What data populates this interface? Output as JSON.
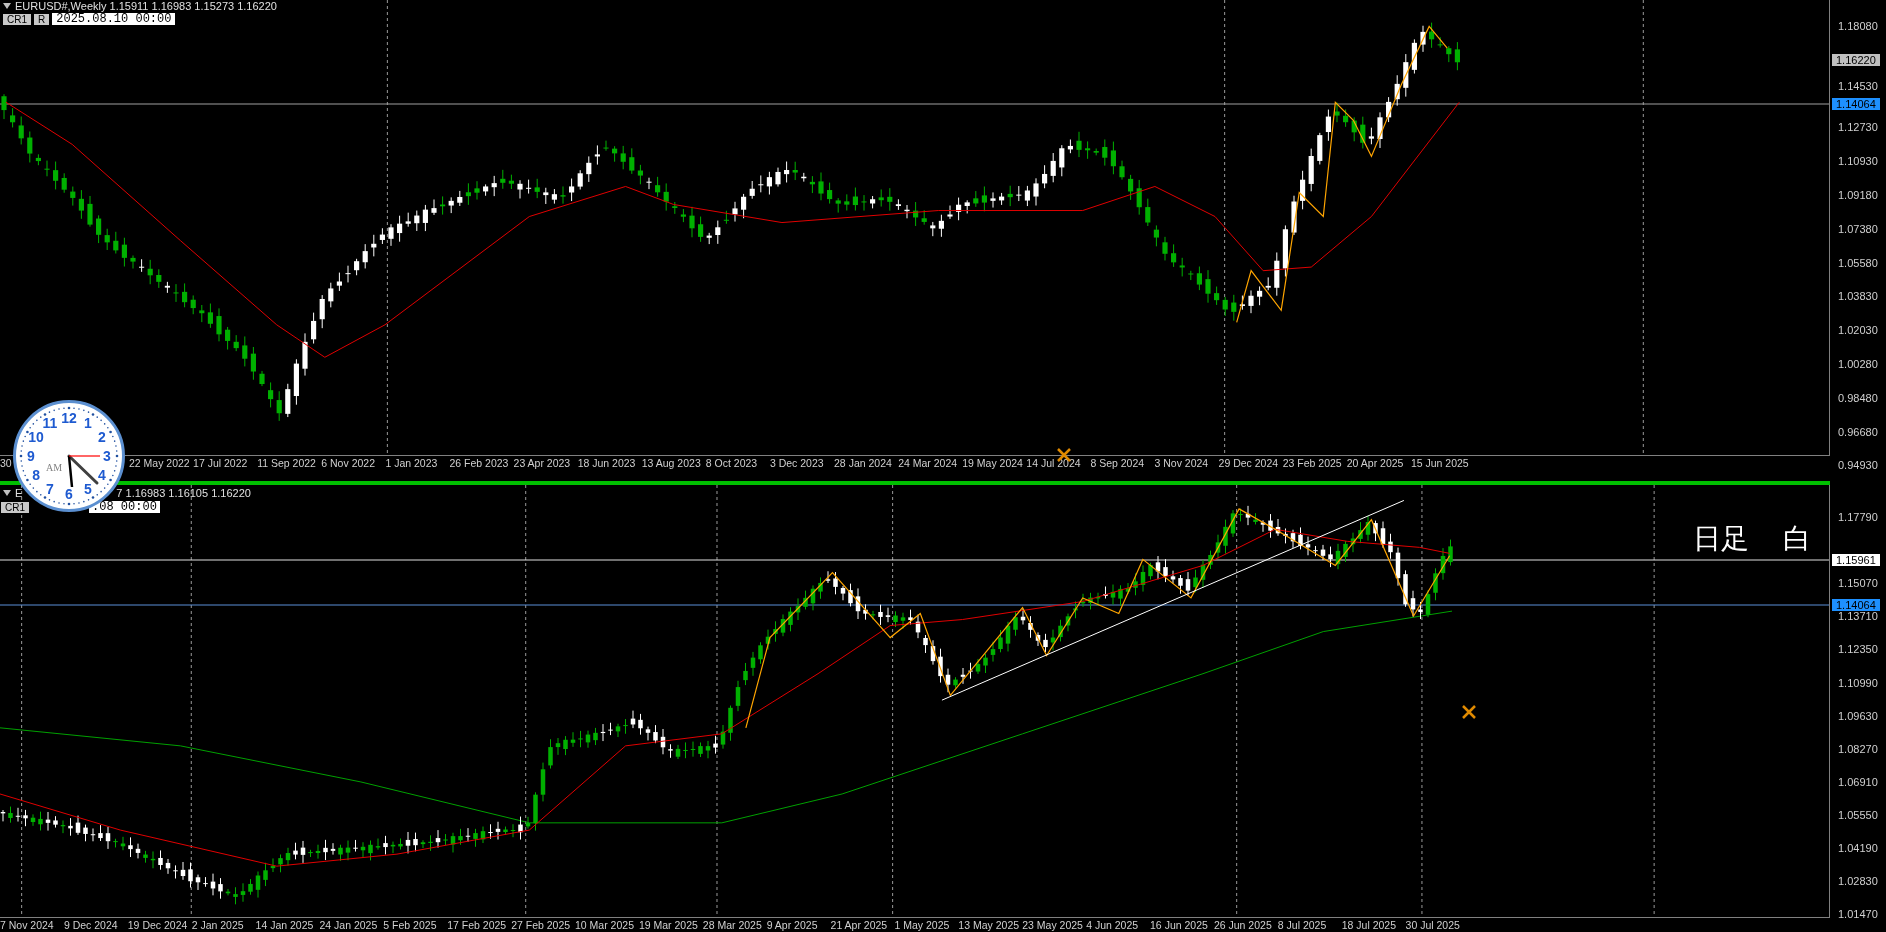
{
  "top_chart": {
    "title": "EURUSD#,Weekly 1.15911 1.16983 1.15273 1.16220",
    "buttons": [
      {
        "label": "CR1"
      },
      {
        "label": "R"
      }
    ],
    "time_field": "2025.08.10 00:00",
    "price_axis": [
      "1.18080",
      "1.14530",
      "1.12730",
      "1.10930",
      "1.09180",
      "1.07380",
      "1.05580",
      "1.03830",
      "1.02030",
      "1.00280",
      "0.98480",
      "0.96680",
      "0.94930"
    ],
    "price_tags": [
      {
        "text": "1.16220",
        "kind": "current"
      },
      {
        "text": "1.14064",
        "kind": "level"
      }
    ],
    "time_axis": [
      "30",
      "22 May 2022",
      "17 Jul 2022",
      "11 Sep 2022",
      "6 Nov 2022",
      "1 Jan 2023",
      "26 Feb 2023",
      "23 Apr 2023",
      "18 Jun 2023",
      "13 Aug 2023",
      "8 Oct 2023",
      "3 Dec 2023",
      "28 Jan 2024",
      "24 Mar 2024",
      "19 May 2024",
      "14 Jul 2024",
      "8 Sep 2024",
      "3 Nov 2024",
      "29 Dec 2024",
      "23 Feb 2025",
      "20 Apr 2025",
      "15 Jun 2025"
    ]
  },
  "bottom_chart": {
    "title_parts": [
      "E",
      "7 1.16983 1.16105 1.16220"
    ],
    "buttons": [
      {
        "label": "CR1"
      }
    ],
    "time_field": ".08 00:00",
    "price_axis": [
      "1.17790",
      "1.15070",
      "1.13710",
      "1.12350",
      "1.10990",
      "1.09630",
      "1.08270",
      "1.06910",
      "1.05550",
      "1.04190",
      "1.02830",
      "1.01470"
    ],
    "price_tags": [
      {
        "text": "1.15961",
        "kind": "marker"
      },
      {
        "text": "1.14064",
        "kind": "level"
      }
    ],
    "time_axis": [
      "7 Nov 2024",
      "9 Dec 2024",
      "19 Dec 2024",
      "2 Jan 2025",
      "14 Jan 2025",
      "24 Jan 2025",
      "5 Feb 2025",
      "17 Feb 2025",
      "27 Feb 2025",
      "10 Mar 2025",
      "19 Mar 2025",
      "28 Mar 2025",
      "9 Apr 2025",
      "21 Apr 2025",
      "1 May 2025",
      "13 May 2025",
      "23 May 2025",
      "4 Jun 2025",
      "16 Jun 2025",
      "26 Jun 2025",
      "8 Jul 2025",
      "18 Jul 2025",
      "30 Jul 2025"
    ],
    "annotation": [
      "日足",
      "白"
    ]
  },
  "clock": {
    "numbers": [
      "12",
      "11",
      "1",
      "10",
      "2",
      "9",
      "3",
      "8",
      "4",
      "7",
      "5",
      "6"
    ],
    "period": "AM"
  }
}
